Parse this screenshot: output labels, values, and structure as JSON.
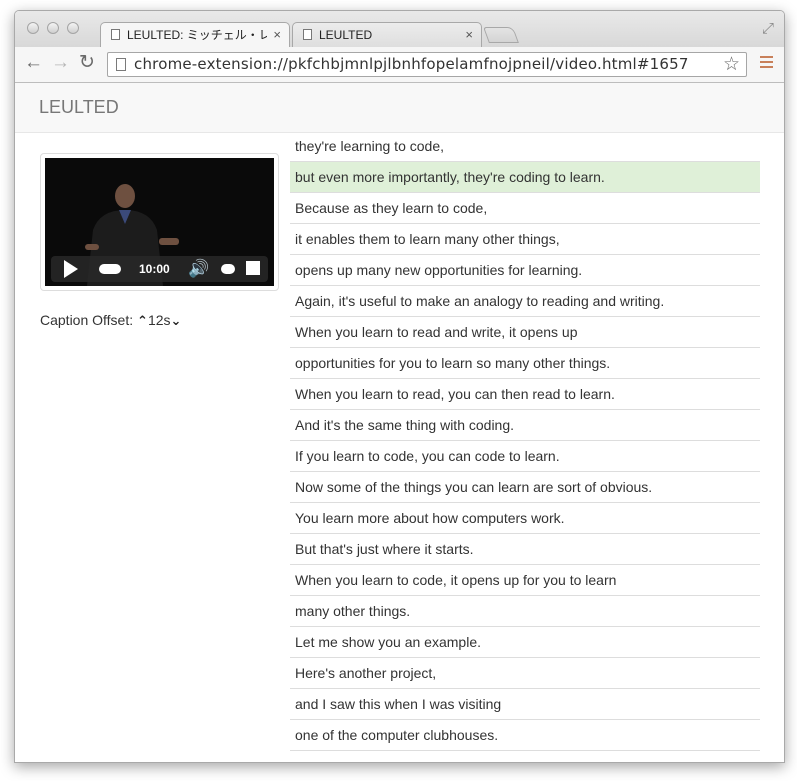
{
  "browser": {
    "tabs": [
      {
        "title": "LEULTED: ミッチェル・レズ",
        "close": "×",
        "active": true
      },
      {
        "title": "LEULTED",
        "close": "×",
        "active": false
      }
    ],
    "address": "chrome-extension://pkfchbjmnlpjlbnhfopelamfnojpneil/video.html#1657",
    "icons": {
      "back": "back-arrow-icon",
      "forward": "forward-arrow-icon",
      "reload": "reload-icon",
      "star": "bookmark-star-icon",
      "menu": "hamburger-menu-icon"
    }
  },
  "app": {
    "brand": "LEULTED"
  },
  "player": {
    "time": "10:00"
  },
  "caption_offset": {
    "label": "Caption Offset:",
    "up": "⌃",
    "value": "12s",
    "down": "⌄"
  },
  "colors": {
    "current_line": "#dff0d8",
    "menu_icon": "#c8805a"
  },
  "transcript": {
    "current_index": 1,
    "lines": [
      "they're learning to code,",
      "but even more importantly, they're coding to learn.",
      "Because as they learn to code,",
      "it enables them to learn many other things,",
      "opens up many new opportunities for learning.",
      "Again, it's useful to make an analogy to reading and writing.",
      "When you learn to read and write, it opens up",
      "opportunities for you to learn so many other things.",
      "When you learn to read, you can then read to learn.",
      "And it's the same thing with coding.",
      "If you learn to code, you can code to learn.",
      "Now some of the things you can learn are sort of obvious.",
      "You learn more about how computers work.",
      "But that's just where it starts.",
      "When you learn to code, it opens up for you to learn",
      "many other things.",
      "Let me show you an example.",
      "Here's another project,",
      "and I saw this when I was visiting",
      "one of the computer clubhouses."
    ]
  }
}
